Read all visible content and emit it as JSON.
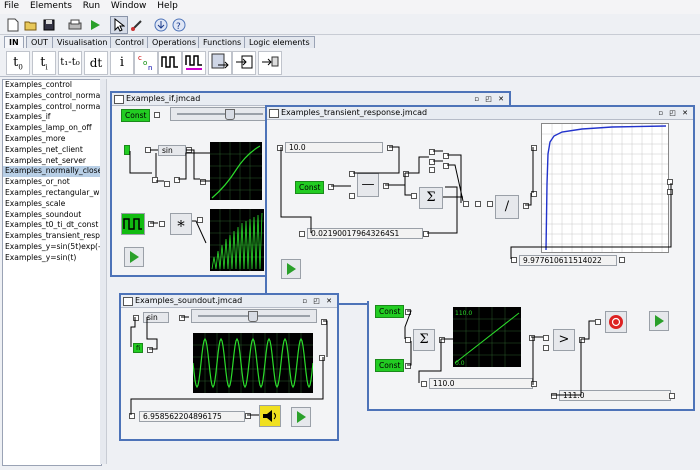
{
  "menu": [
    "File",
    "Elements",
    "Run",
    "Window",
    "Help"
  ],
  "tabs": [
    {
      "label": "IN",
      "selected": true
    },
    {
      "label": "OUT",
      "selected": false
    },
    {
      "label": "Visualisation",
      "selected": false
    },
    {
      "label": "Control",
      "selected": false
    },
    {
      "label": "Operations",
      "selected": false
    },
    {
      "label": "Functions",
      "selected": false
    },
    {
      "label": "Logic elements",
      "selected": false
    }
  ],
  "palette": {
    "t0": "t",
    "t0_sub": "0",
    "ti": "t",
    "ti_sub": "i",
    "tdiff": "t₁-t₀",
    "dt": "dt",
    "i": "i"
  },
  "examples": [
    "Examples_control",
    "Examples_control_normal",
    "Examples_control_normal",
    "Examples_if",
    "Examples_lamp_on_off",
    "Examples_more",
    "Examples_net_client",
    "Examples_net_server",
    "Examples_normally_close",
    "Examples_or_not",
    "Examples_rectangular_wa",
    "Examples_scale",
    "Examples_soundout",
    "Examples_t0_ti_dt_const",
    "Examples_transient_respo",
    "Examples_y=sin(5t)exp(-0.",
    "Examples_y=sin(t)"
  ],
  "selected_example": "Examples_normally_close",
  "win_if": {
    "title": "Examples_if.jmcad",
    "const": "Const",
    "sin": "sin",
    "mult": "*"
  },
  "win_transient": {
    "title": "Examples_transient_response.jmcad",
    "input": "10.0",
    "const": "Const",
    "minus": "—",
    "sigma": "Σ",
    "divide": "/",
    "value_a": "0.021900179643264S1",
    "value_b": "9.977610611514022"
  },
  "win_sound": {
    "title": "Examples_soundout.jmcad",
    "sin": "sin",
    "tag": "fi",
    "value": "6.958562204896175"
  },
  "win_compare": {
    "const_a": "Const",
    "const_b": "Const",
    "sigma": "Σ",
    "gt": ">",
    "value_a": "110.0",
    "value_b": "111.0",
    "scope_top": "110.0",
    "scope_bottom": "0.0"
  },
  "colors": {
    "accent": "#4d73b8",
    "const_green": "#22cc22",
    "trace": "#2bdc2b",
    "curve": "#2233cc"
  }
}
